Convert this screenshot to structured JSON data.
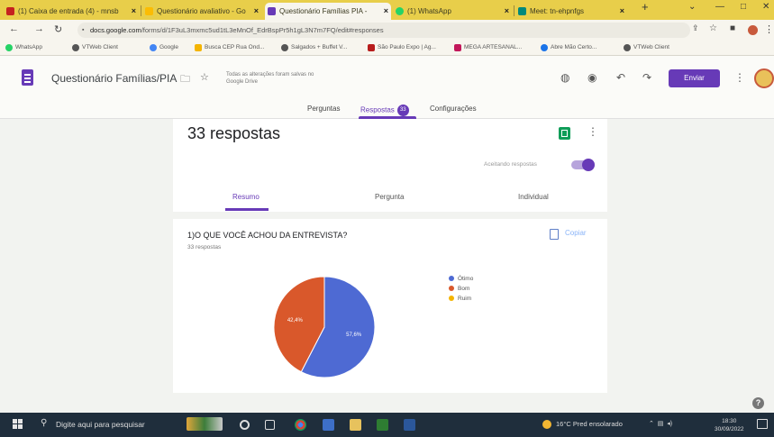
{
  "browser": {
    "tabs": [
      {
        "label": "(1) Caixa de entrada (4) - mnsb",
        "color": "#c5221f"
      },
      {
        "label": "Questionário avaliativo - Go",
        "color": "#fbbc04"
      },
      {
        "label": "Questionário Famílias PIA -",
        "color": "#673ab7"
      },
      {
        "label": "(1) WhatsApp",
        "color": "#25d366"
      },
      {
        "label": "Meet: tn-ehpnfgs",
        "color": "#00897b"
      }
    ],
    "new_tab": "+",
    "window": {
      "minimize": "—",
      "restore": "⌄",
      "close": "✕"
    },
    "address": {
      "host": "docs.google.com",
      "path": "/forms/d/1F3uL3mxmc5ud1tL3eMnOf_EdrBspPr5h1gL3N7m7FQ/edit#responses"
    },
    "bookmarks": [
      {
        "label": "WhatsApp",
        "color": "#25d366"
      },
      {
        "label": "VTWeb Client",
        "color": "#555555"
      },
      {
        "label": "Google",
        "color": "#4285f4"
      },
      {
        "label": "Busca CEP Rua Ond...",
        "color": "#f4b400"
      },
      {
        "label": "Salgados + Buffet V...",
        "color": "#555555"
      },
      {
        "label": "São Paulo Expo | Ag...",
        "color": "#b71c1c"
      },
      {
        "label": "MEGA ARTESANAL...",
        "color": "#c2185b"
      },
      {
        "label": "Abre Mão Certo...",
        "color": "#1a73e8"
      },
      {
        "label": "VTWeb Client",
        "color": "#555555"
      }
    ]
  },
  "form_header": {
    "title": "Questionário Famílias/PIA",
    "save_note": "Todas as alterações foram salvas no Google Drive",
    "send_label": "Enviar"
  },
  "form_tabs": {
    "questions": "Perguntas",
    "responses": "Respostas",
    "responses_count": "33",
    "settings": "Configurações"
  },
  "summary": {
    "title": "33 respostas",
    "accepting_label": "Aceitando respostas",
    "tabs": {
      "summary": "Resumo",
      "question": "Pergunta",
      "individual": "Individual"
    }
  },
  "question": {
    "title": "1)O QUE VOCÊ ACHOU DA ENTREVISTA?",
    "count": "33 respostas",
    "copy_label": "Copiar"
  },
  "chart_data": {
    "type": "pie",
    "categories": [
      "Ótimo",
      "Bom",
      "Ruim"
    ],
    "values": [
      57.6,
      42.4,
      0
    ],
    "colors": [
      "#4e6ad3",
      "#d9582b",
      "#f4b400"
    ],
    "data_labels": [
      "57,6%",
      "42,4%",
      ""
    ]
  },
  "taskbar": {
    "search_placeholder": "Digite aqui para pesquisar",
    "weather": "16°C  Pred ensolarado",
    "time": "18:30",
    "date": "30/09/2022"
  }
}
